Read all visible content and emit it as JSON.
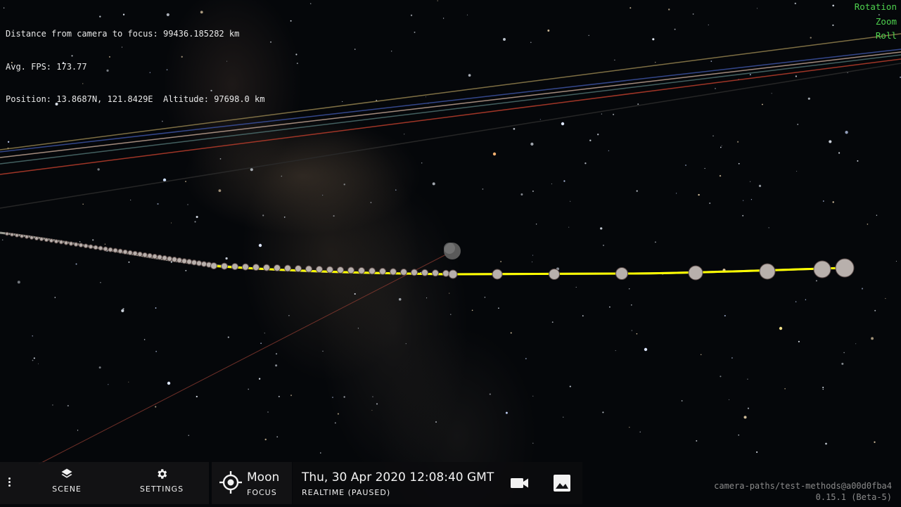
{
  "hud": {
    "distance_line": "Distance from camera to focus: 99436.185282 km",
    "fps_line": "Avg. FPS: 173.77",
    "position_line": "Position: 13.8687N, 121.8429E  Altitude: 97698.0 km"
  },
  "controls_legend": {
    "rotation": "Rotation",
    "zoom": "Zoom",
    "roll": "Roll"
  },
  "toolbar": {
    "menu_icon": "more-vert-icon",
    "scene_label": "SCENE",
    "scene_icon": "layers-icon",
    "settings_label": "SETTINGS",
    "settings_icon": "gear-icon"
  },
  "focus": {
    "name": "Moon",
    "label": "FOCUS",
    "icon": "crosshair-target-icon"
  },
  "time": {
    "datetime": "Thu, 30 Apr 2020 12:08:40 GMT",
    "mode": "REALTIME (PAUSED)",
    "camera_icon": "video-camera-icon",
    "image_icon": "image-icon"
  },
  "version": {
    "branch": "camera-paths/test-methods@a00d0fba4",
    "release": "0.15.1 (Beta-5)"
  },
  "colors": {
    "legend_green": "#4ed24e",
    "trajectory_yellow": "#ffff00",
    "panel_bg": "#141416"
  }
}
